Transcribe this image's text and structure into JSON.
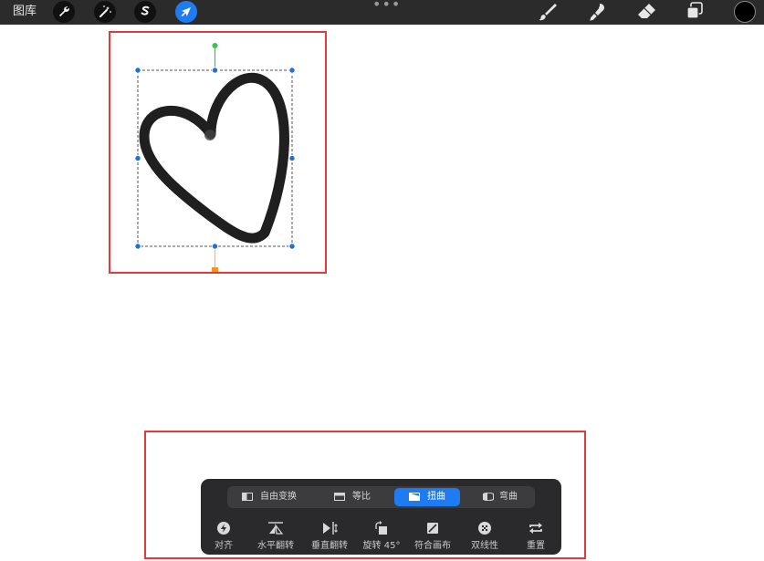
{
  "top_bar": {
    "gallery_label": "图库",
    "tools": [
      {
        "name": "actions",
        "icon": "wrench-icon"
      },
      {
        "name": "adjustments",
        "icon": "magic-wand-icon"
      },
      {
        "name": "selection",
        "icon": "selection-s-icon"
      },
      {
        "name": "transform",
        "icon": "arrow-cursor-icon",
        "active": true
      }
    ],
    "more_label": "•••",
    "right_tools": [
      {
        "name": "brush",
        "icon": "brush-icon"
      },
      {
        "name": "smudge",
        "icon": "smudge-icon"
      },
      {
        "name": "eraser",
        "icon": "eraser-icon"
      },
      {
        "name": "layers",
        "icon": "layers-icon"
      }
    ],
    "current_color": "#000000"
  },
  "colors": {
    "active_blue": "#1e7cf2",
    "highlight_red": "#e23b3b",
    "rotate_handle": "#2ecc40",
    "snap_handle": "#ff9500"
  },
  "transform_modes": [
    {
      "label": "自由变换",
      "icon": "free-transform-icon",
      "active": false
    },
    {
      "label": "等比",
      "icon": "uniform-icon",
      "active": false
    },
    {
      "label": "扭曲",
      "icon": "distort-icon",
      "active": true
    },
    {
      "label": "弯曲",
      "icon": "warp-icon",
      "active": false
    }
  ],
  "actions": [
    {
      "label": "对齐",
      "icon": "snapping-icon"
    },
    {
      "label": "水平翻转",
      "icon": "flip-horizontal-icon"
    },
    {
      "label": "垂直翻转",
      "icon": "flip-vertical-icon"
    },
    {
      "label": "旋转 45°",
      "icon": "rotate-45-icon"
    },
    {
      "label": "符合画布",
      "icon": "fit-to-canvas-icon"
    },
    {
      "label": "双线性",
      "icon": "bilinear-icon"
    },
    {
      "label": "重置",
      "icon": "reset-icon"
    }
  ]
}
